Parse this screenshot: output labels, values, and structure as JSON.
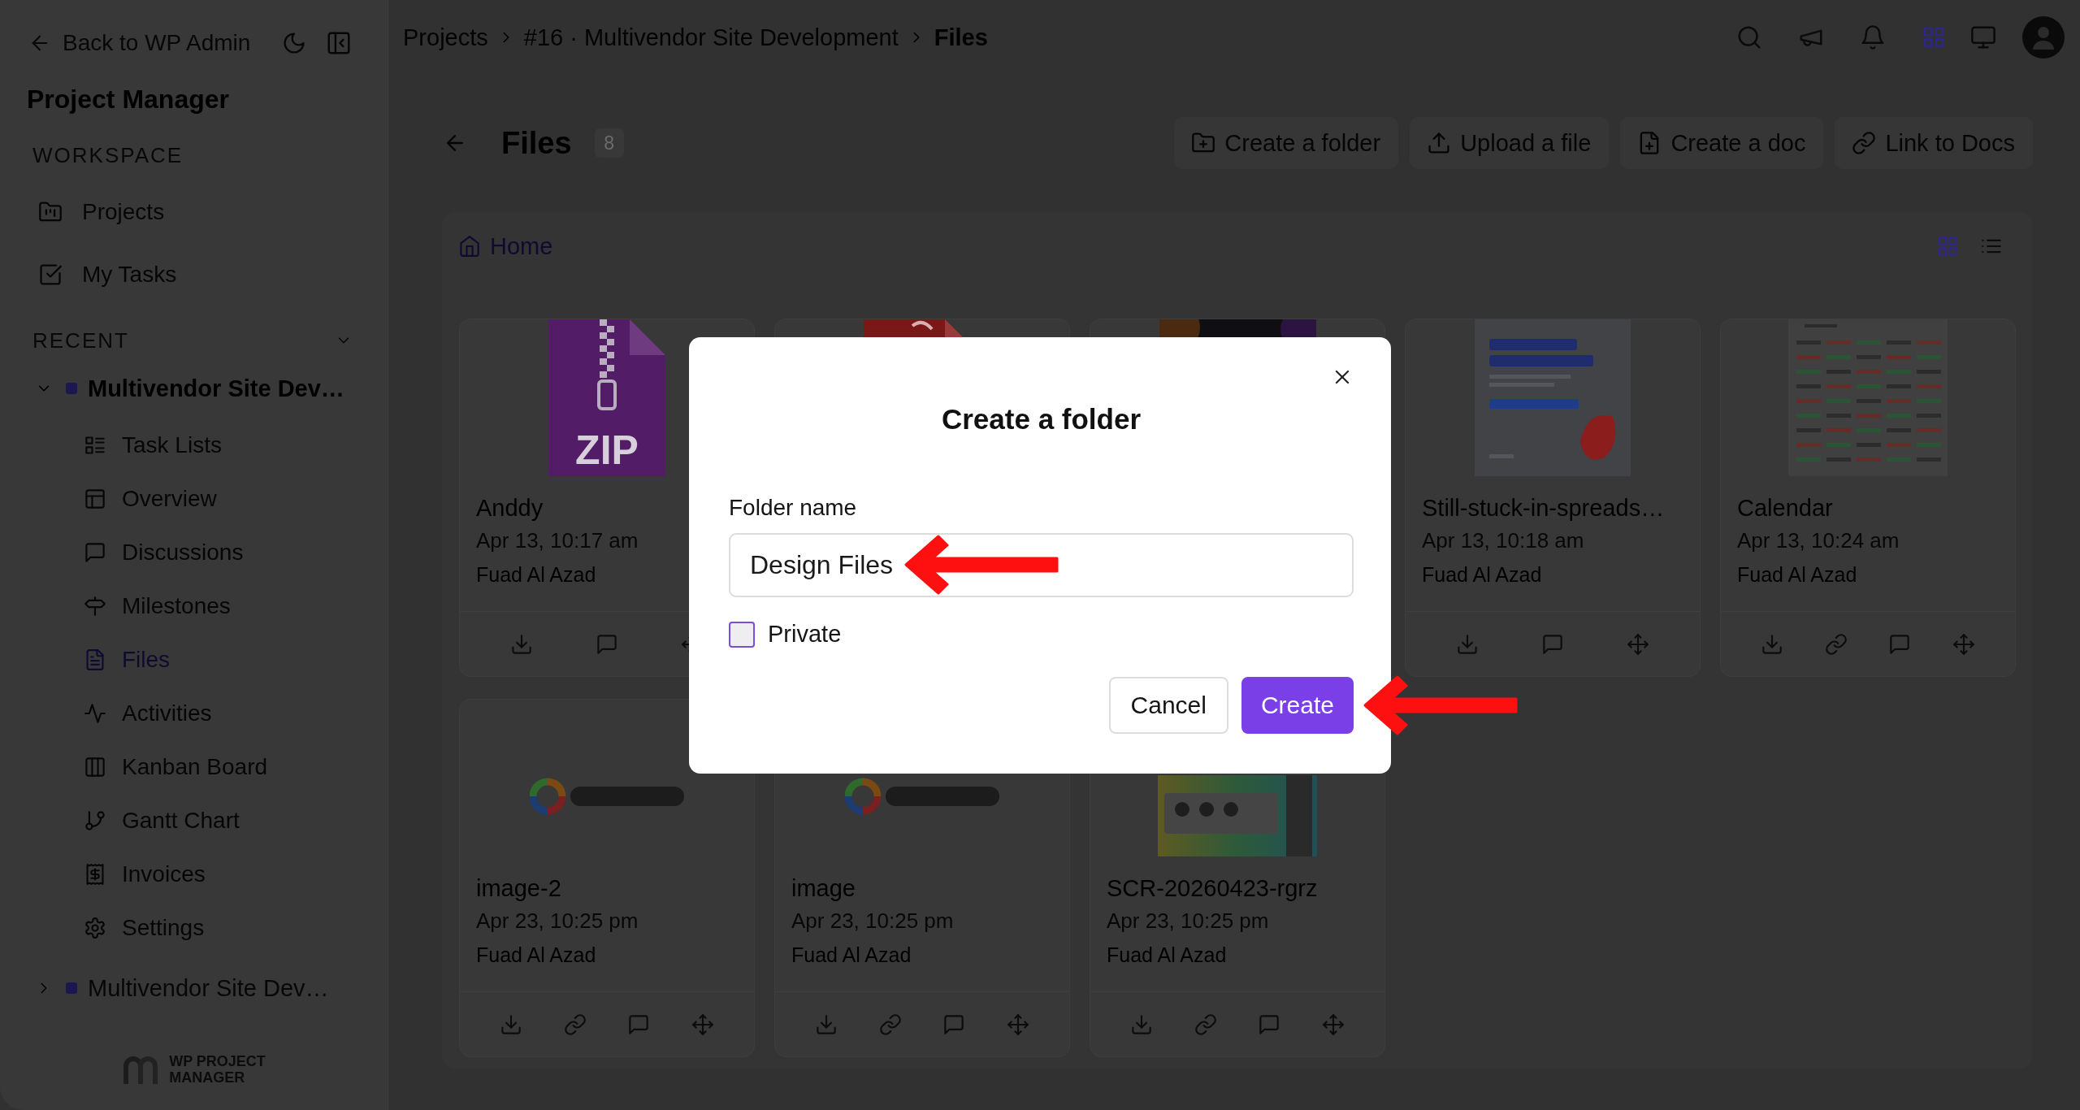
{
  "sidebar": {
    "back_link": "Back to WP Admin",
    "title": "Project Manager",
    "workspace": {
      "heading": "WORKSPACE",
      "items": [
        {
          "label": "Projects"
        },
        {
          "label": "My Tasks"
        }
      ]
    },
    "recent": {
      "heading": "RECENT",
      "expanded": true,
      "projects": [
        {
          "name": "Multivendor Site Dev…",
          "expanded": true,
          "children": [
            {
              "label": "Task Lists",
              "selected": false
            },
            {
              "label": "Overview",
              "selected": false
            },
            {
              "label": "Discussions",
              "selected": false
            },
            {
              "label": "Milestones",
              "selected": false
            },
            {
              "label": "Files",
              "selected": true
            },
            {
              "label": "Activities",
              "selected": false
            },
            {
              "label": "Kanban Board",
              "selected": false
            },
            {
              "label": "Gantt Chart",
              "selected": false
            },
            {
              "label": "Invoices",
              "selected": false
            },
            {
              "label": "Settings",
              "selected": false
            }
          ]
        },
        {
          "name": "Multivendor Site Dev…",
          "expanded": false
        }
      ]
    },
    "logo_text": [
      "WP PROJECT",
      "MANAGER"
    ]
  },
  "topbar": {
    "breadcrumb": [
      "Projects",
      "#16 · Multivendor Site Development",
      "Files"
    ]
  },
  "header": {
    "title": "Files",
    "count": "8",
    "actions": [
      "Create a folder",
      "Upload a file",
      "Create a doc",
      "Link to Docs"
    ]
  },
  "browser": {
    "path": [
      "Home"
    ],
    "view_modes": [
      {
        "selected": true
      },
      {
        "selected": false
      }
    ],
    "files": [
      {
        "kind": "zip",
        "thumb_label": "ZIP",
        "name": "Anddy",
        "date": "Apr 13, 10:17 am",
        "author": "Fuad Al Azad",
        "link_action": false
      },
      {
        "kind": "pdf"
      },
      {
        "kind": "photo"
      },
      {
        "kind": "flyer",
        "name": "Still-stuck-in-spreads…",
        "date": "Apr 13, 10:18 am",
        "author": "Fuad Al Azad",
        "link_action": false
      },
      {
        "kind": "calendar",
        "name": "Calendar",
        "date": "Apr 13, 10:24 am",
        "author": "Fuad Al Azad",
        "link_action": true
      },
      {
        "kind": "logo",
        "name": "image-2",
        "date": "Apr 23, 10:25 pm",
        "author": "Fuad Al Azad",
        "link_action": true
      },
      {
        "kind": "logo",
        "name": "image",
        "date": "Apr 23, 10:25 pm",
        "author": "Fuad Al Azad",
        "link_action": true
      },
      {
        "kind": "screenshot",
        "name": "SCR-20260423-rgrz",
        "date": "Apr 23, 10:25 pm",
        "author": "Fuad Al Azad",
        "link_action": true
      }
    ]
  },
  "dialog": {
    "title": "Create a folder",
    "field": {
      "label": "Folder name",
      "value": "Design Files",
      "callout_arrow": true
    },
    "private": {
      "label": "Private",
      "checked": false
    },
    "buttons": [
      {
        "label": "Cancel",
        "kind": "secondary"
      },
      {
        "label": "Create",
        "kind": "primary",
        "callout_arrow": true
      }
    ]
  }
}
